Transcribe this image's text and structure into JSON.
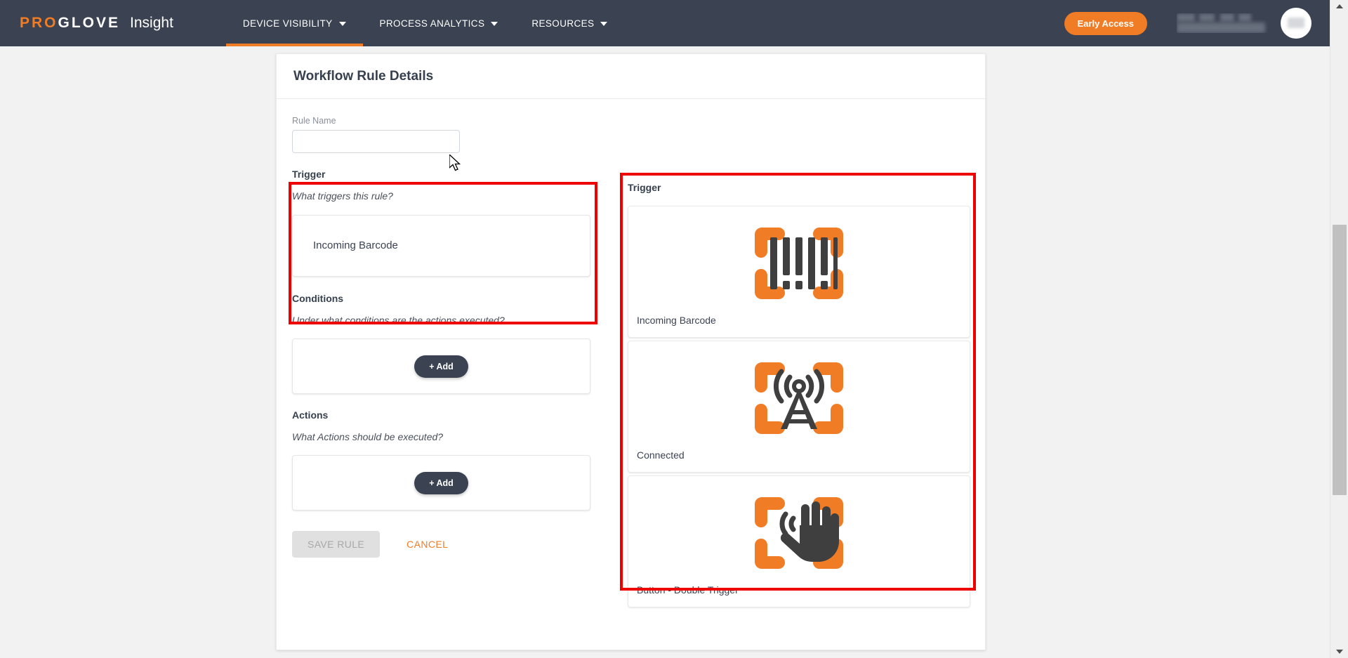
{
  "header": {
    "brand": {
      "pro": "PRO",
      "glove": "GLOVE",
      "product": "Insight"
    },
    "nav": [
      {
        "label": "DEVICE VISIBILITY",
        "icon": "chevron-down-icon",
        "active": true
      },
      {
        "label": "PROCESS ANALYTICS",
        "icon": "chevron-down-icon",
        "active": false
      },
      {
        "label": "RESOURCES",
        "icon": "chevron-down-icon",
        "active": false
      }
    ],
    "early_access_label": "Early Access",
    "accent_color": "#f07d26",
    "bar_color": "#3b4252"
  },
  "card": {
    "title": "Workflow Rule Details"
  },
  "form": {
    "rule_name": {
      "label": "Rule Name",
      "value": "",
      "placeholder": ""
    },
    "trigger": {
      "title": "Trigger",
      "question": "What triggers this rule?",
      "selected": "Incoming Barcode"
    },
    "conditions": {
      "title": "Conditions",
      "question": "Under what conditions are the actions executed?",
      "add_label": "+ Add"
    },
    "actions": {
      "title": "Actions",
      "question": "What Actions should be executed?",
      "add_label": "+ Add"
    },
    "footer": {
      "save_label": "SAVE RULE",
      "save_disabled": true,
      "cancel_label": "CANCEL"
    }
  },
  "palette": {
    "title": "Trigger",
    "tiles": [
      {
        "label": "Incoming Barcode",
        "icon": "barcode-scan-icon"
      },
      {
        "label": "Connected",
        "icon": "antenna-tower-scan-icon"
      },
      {
        "label": "Button - Double Trigger",
        "icon": "hand-gesture-scan-icon"
      }
    ]
  },
  "annotations": {
    "color": "#ee0000",
    "boxes": [
      "trigger-section-highlight",
      "trigger-palette-highlight"
    ]
  },
  "scrollbar": {
    "up_icon": "scroll-up-arrow-icon",
    "down_icon": "scroll-down-arrow-icon"
  }
}
